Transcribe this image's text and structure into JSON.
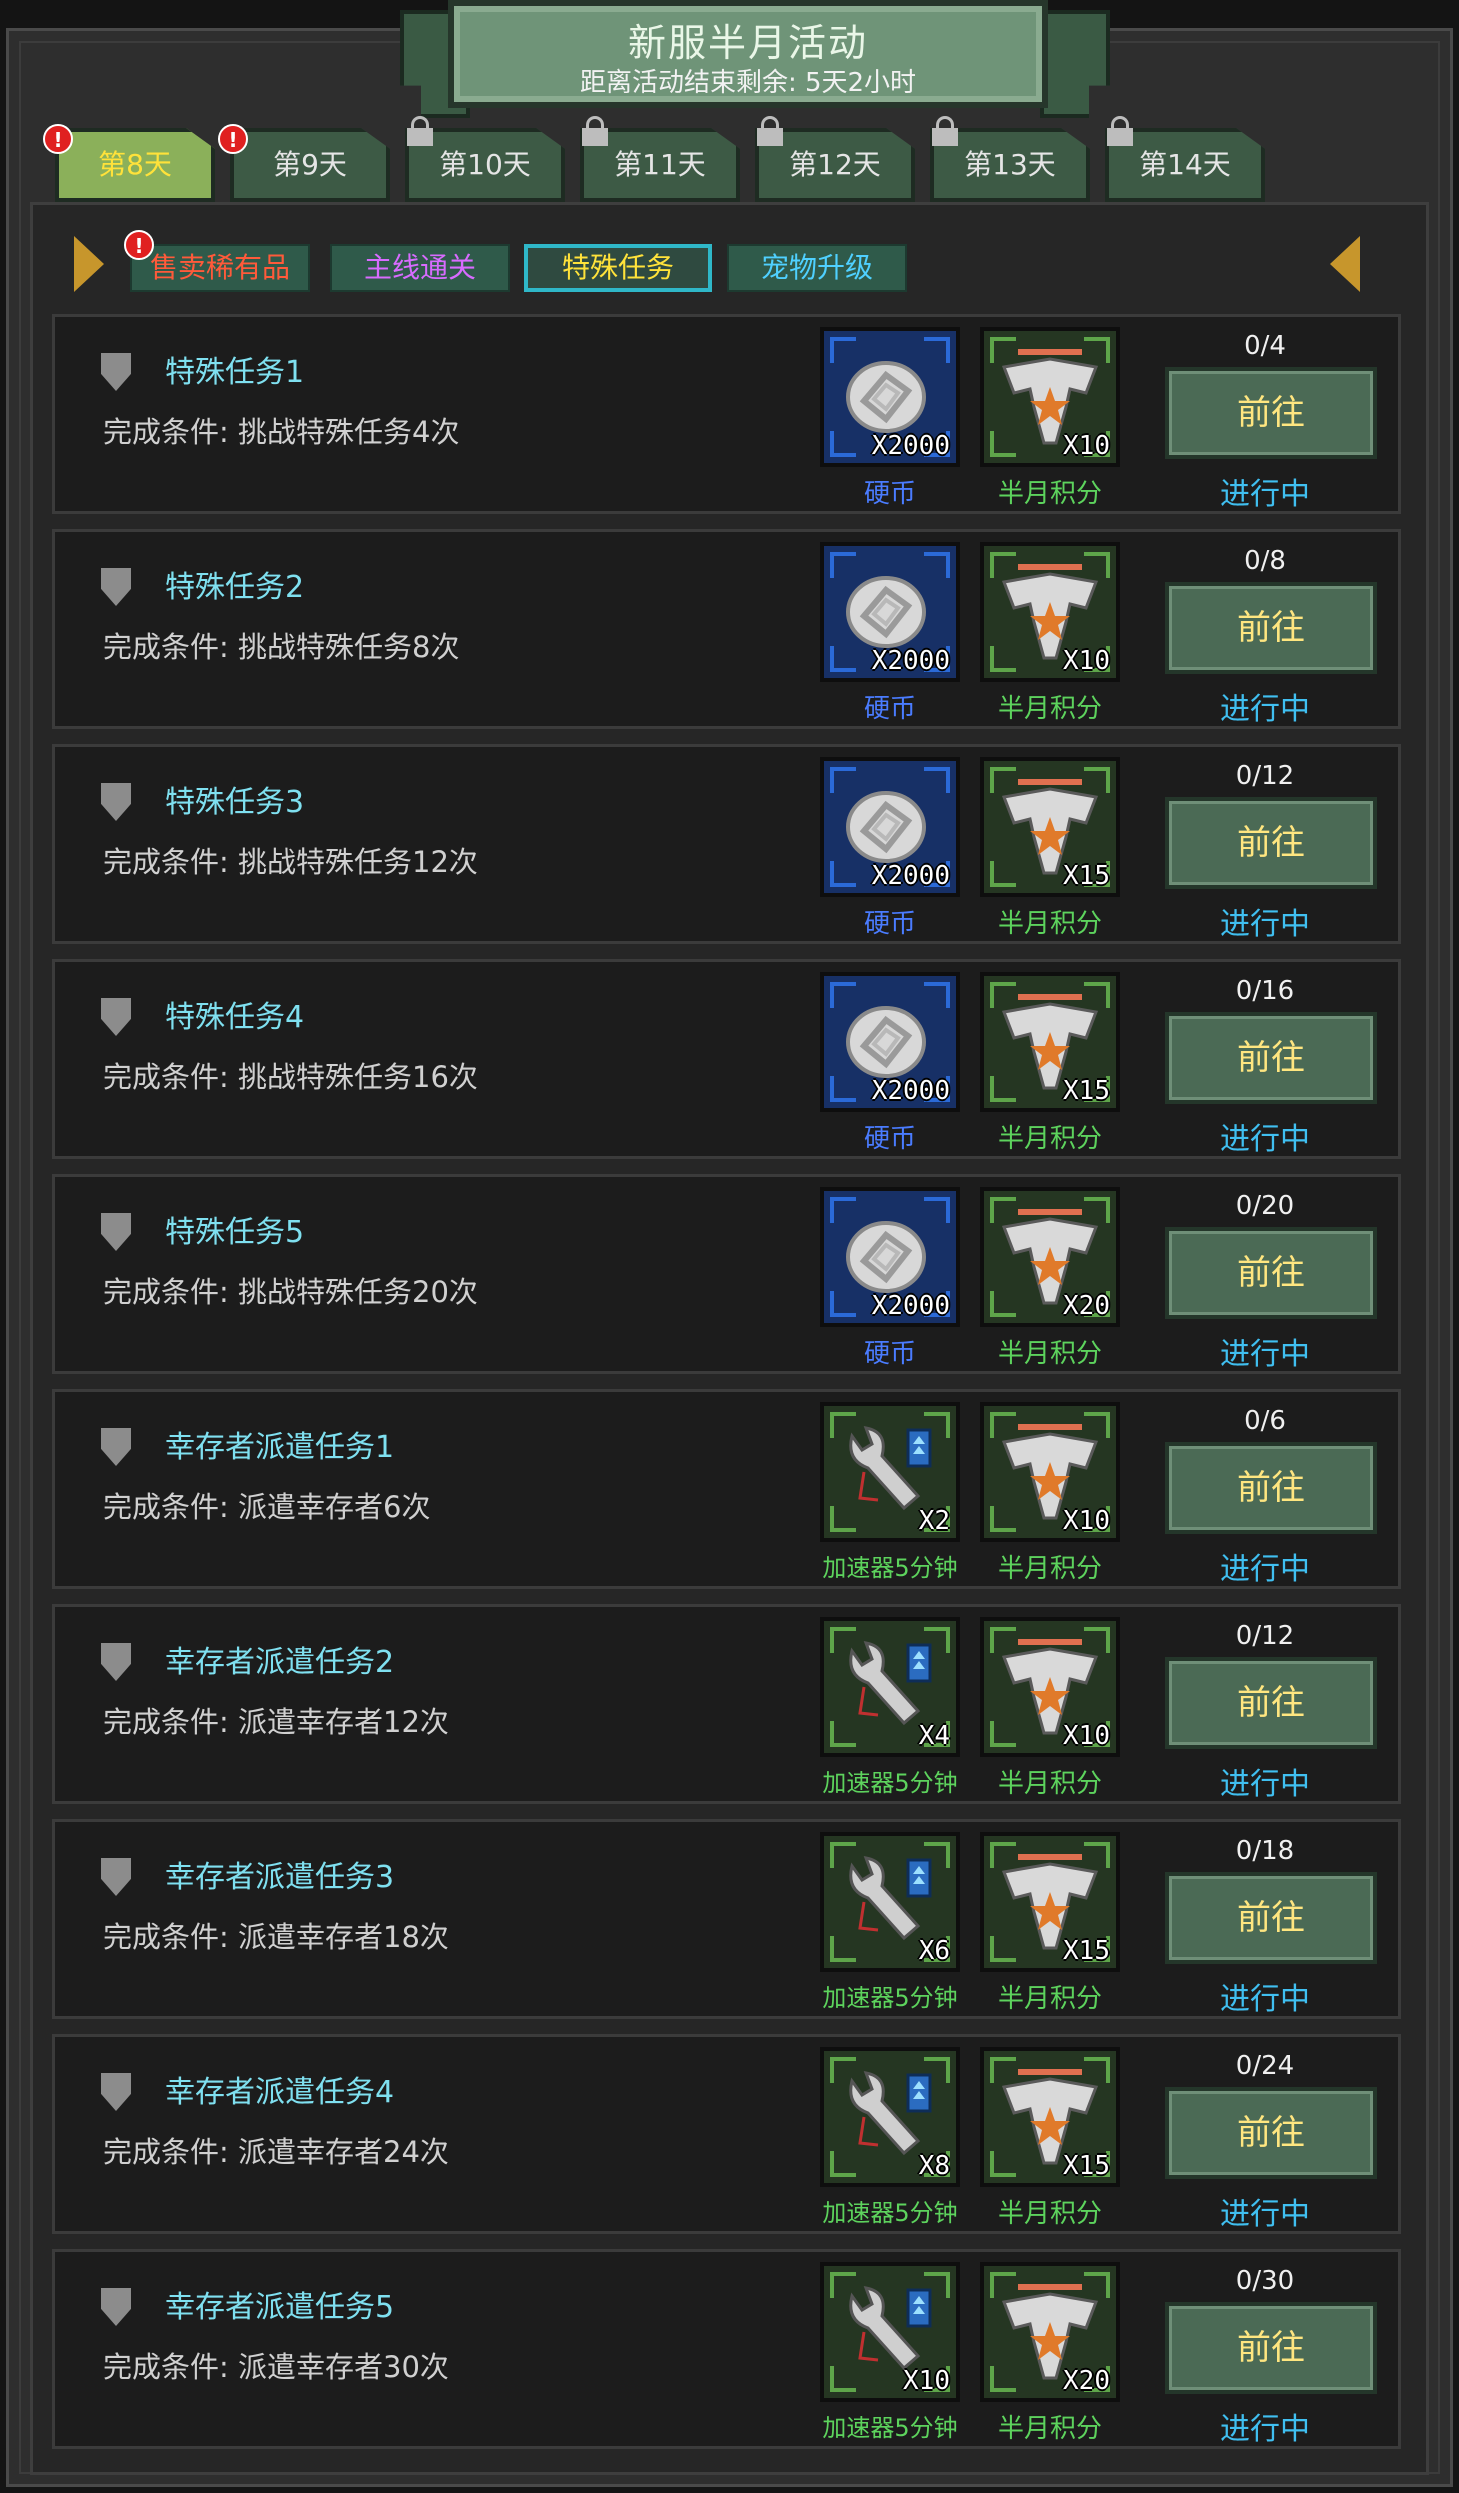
{
  "header": {
    "title": "新服半月活动",
    "countdown": "距离活动结束剩余: 5天2小时"
  },
  "tabs": [
    {
      "label": "第8天",
      "alert": "!",
      "locked": false,
      "active": true
    },
    {
      "label": "第9天",
      "alert": "!",
      "locked": false,
      "active": false
    },
    {
      "label": "第10天",
      "locked": true,
      "active": false
    },
    {
      "label": "第11天",
      "locked": true,
      "active": false
    },
    {
      "label": "第12天",
      "locked": true,
      "active": false
    },
    {
      "label": "第13天",
      "locked": true,
      "active": false
    },
    {
      "label": "第14天",
      "locked": true,
      "active": false
    }
  ],
  "categories": [
    {
      "label": "售卖稀有品",
      "color": "#ff5a3a",
      "alert": "!",
      "active": false
    },
    {
      "label": "主线通关",
      "color": "#d86bff",
      "active": false
    },
    {
      "label": "特殊任务",
      "color": "#ffe23a",
      "active": true
    },
    {
      "label": "宠物升级",
      "color": "#4fd0ff",
      "active": false
    }
  ],
  "go_label": "前往",
  "status_label": "进行中",
  "tasks": [
    {
      "title": "特殊任务1",
      "condition": "完成条件: 挑战特殊任务4次",
      "progress": "0/4",
      "reward1": {
        "icon": "coin-icon",
        "qty": "X2000",
        "name": "硬币"
      },
      "reward2": {
        "icon": "eagle-points-icon",
        "qty": "X10",
        "name": "半月积分"
      }
    },
    {
      "title": "特殊任务2",
      "condition": "完成条件: 挑战特殊任务8次",
      "progress": "0/8",
      "reward1": {
        "icon": "coin-icon",
        "qty": "X2000",
        "name": "硬币"
      },
      "reward2": {
        "icon": "eagle-points-icon",
        "qty": "X10",
        "name": "半月积分"
      }
    },
    {
      "title": "特殊任务3",
      "condition": "完成条件: 挑战特殊任务12次",
      "progress": "0/12",
      "reward1": {
        "icon": "coin-icon",
        "qty": "X2000",
        "name": "硬币"
      },
      "reward2": {
        "icon": "eagle-points-icon",
        "qty": "X15",
        "name": "半月积分"
      }
    },
    {
      "title": "特殊任务4",
      "condition": "完成条件: 挑战特殊任务16次",
      "progress": "0/16",
      "reward1": {
        "icon": "coin-icon",
        "qty": "X2000",
        "name": "硬币"
      },
      "reward2": {
        "icon": "eagle-points-icon",
        "qty": "X15",
        "name": "半月积分"
      }
    },
    {
      "title": "特殊任务5",
      "condition": "完成条件: 挑战特殊任务20次",
      "progress": "0/20",
      "reward1": {
        "icon": "coin-icon",
        "qty": "X2000",
        "name": "硬币"
      },
      "reward2": {
        "icon": "eagle-points-icon",
        "qty": "X20",
        "name": "半月积分"
      }
    },
    {
      "title": "幸存者派遣任务1",
      "condition": "完成条件: 派遣幸存者6次",
      "progress": "0/6",
      "reward1": {
        "icon": "accelerator-icon",
        "qty": "X2",
        "name": "加速器5分钟"
      },
      "reward2": {
        "icon": "eagle-points-icon",
        "qty": "X10",
        "name": "半月积分"
      }
    },
    {
      "title": "幸存者派遣任务2",
      "condition": "完成条件: 派遣幸存者12次",
      "progress": "0/12",
      "reward1": {
        "icon": "accelerator-icon",
        "qty": "X4",
        "name": "加速器5分钟"
      },
      "reward2": {
        "icon": "eagle-points-icon",
        "qty": "X10",
        "name": "半月积分"
      }
    },
    {
      "title": "幸存者派遣任务3",
      "condition": "完成条件: 派遣幸存者18次",
      "progress": "0/18",
      "reward1": {
        "icon": "accelerator-icon",
        "qty": "X6",
        "name": "加速器5分钟"
      },
      "reward2": {
        "icon": "eagle-points-icon",
        "qty": "X15",
        "name": "半月积分"
      }
    },
    {
      "title": "幸存者派遣任务4",
      "condition": "完成条件: 派遣幸存者24次",
      "progress": "0/24",
      "reward1": {
        "icon": "accelerator-icon",
        "qty": "X8",
        "name": "加速器5分钟"
      },
      "reward2": {
        "icon": "eagle-points-icon",
        "qty": "X15",
        "name": "半月积分"
      }
    },
    {
      "title": "幸存者派遣任务5",
      "condition": "完成条件: 派遣幸存者30次",
      "progress": "0/30",
      "reward1": {
        "icon": "accelerator-icon",
        "qty": "X10",
        "name": "加速器5分钟"
      },
      "reward2": {
        "icon": "eagle-points-icon",
        "qty": "X20",
        "name": "半月积分"
      }
    }
  ]
}
